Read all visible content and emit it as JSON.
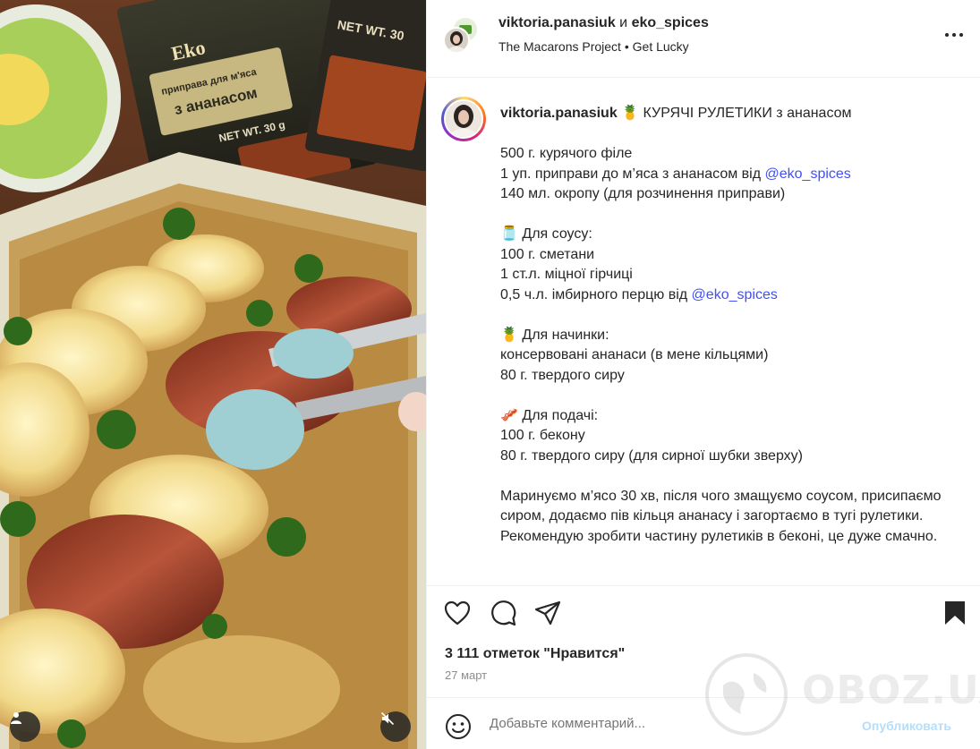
{
  "header": {
    "user1": "viktoria.panasiuk",
    "conj": "и",
    "user2": "eko_spices",
    "audio_artist": "The Macarons Project",
    "separator": "•",
    "audio_track": "Get Lucky"
  },
  "caption": {
    "username": "viktoria.panasiuk",
    "title_emoji": "🍍",
    "title": "КУРЯЧІ РУЛЕТИКИ з ананасом",
    "lines": [
      {
        "text": "500 г. курячого філе"
      },
      {
        "text": "1 уп. приправи до м’яса з ананасом від ",
        "mention": "@eko_spices"
      },
      {
        "text": "140 мл. окропу (для розчинення приправи)"
      },
      {
        "text": ""
      },
      {
        "emoji": "🫙",
        "text": "Для соусу:"
      },
      {
        "text": "100 г. сметани"
      },
      {
        "text": "1 ст.л. міцної гірчиці"
      },
      {
        "text": "0,5 ч.л. імбирного перцю від ",
        "mention": "@eko_spices"
      },
      {
        "text": ""
      },
      {
        "emoji": "🍍",
        "text": "Для начинки:"
      },
      {
        "text": "консервовані ананаси (в мене кільцями)"
      },
      {
        "text": "80 г. твердого сиру"
      },
      {
        "text": ""
      },
      {
        "emoji": "🥓",
        "text": "Для подачі:"
      },
      {
        "text": "100 г. бекону"
      },
      {
        "text": "80 г. твердого сиру (для сирної шубки зверху)"
      },
      {
        "text": ""
      },
      {
        "text": "Маринуємо м’ясо 30 хв, після чого змащуємо соусом, присипаємо сиром, додаємо пів кільця ананасу і загортаємо в тугі рулетики.",
        "wrap": true
      },
      {
        "text": "Рекомендую зробити частину рулетиків в беконі, це дуже смачно.",
        "wrap": true
      }
    ]
  },
  "actions": {
    "like_icon": "heart-icon",
    "comment_icon": "comment-icon",
    "share_icon": "share-icon",
    "save_icon": "bookmark-icon",
    "likes": "3 111 отметок \"Нравится\"",
    "date": "27 март"
  },
  "comment": {
    "placeholder": "Добавьте комментарий...",
    "post": "Опубликовать"
  },
  "media": {
    "package_brand": "Eko",
    "package_line1": "приправа для м'яса",
    "package_line2": "з ананасом",
    "package_weight": "NET WT. 30 g",
    "package2_weight": "NET WT. 30"
  },
  "watermark": "OBOZ.UA"
}
